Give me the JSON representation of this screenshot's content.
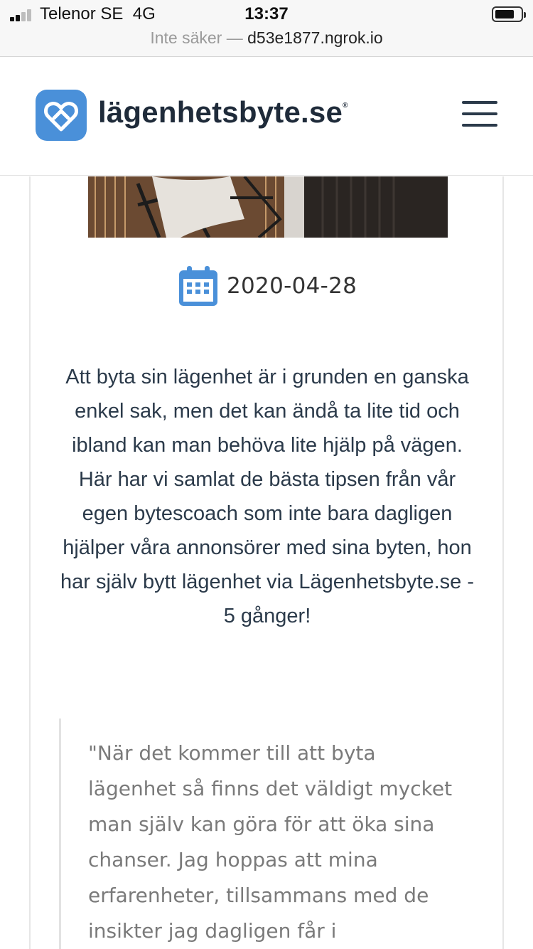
{
  "status_bar": {
    "carrier": "Telenor SE",
    "network": "4G",
    "time": "13:37"
  },
  "url_bar": {
    "security": "Inte säker —",
    "host": "d53e1877.ngrok.io"
  },
  "header": {
    "logo_text": "lägenhetsbyte.se",
    "logo_mark": "®"
  },
  "article": {
    "date": "2020-04-28",
    "intro": "Att byta sin lägenhet är i grunden en ganska enkel sak, men det kan ändå ta lite tid och ibland kan man behöva lite hjälp på vägen. Här har vi samlat de bästa tipsen från vår egen bytescoach som inte bara dagligen hjälper våra annonsörer med sina byten, hon har själv bytt lägenhet via Lägenhetsbyte.se - 5 gånger!",
    "quote": "\"När det kommer till att byta lägenhet så finns det väldigt mycket man själv kan göra för att öka sina chanser. Jag hoppas att mina erfarenheter, tillsammans med de insikter jag dagligen får i"
  },
  "colors": {
    "brand_blue": "#4a90d9",
    "text_dark": "#2b3a4a",
    "quote_gray": "#7a7a7a"
  },
  "icons": {
    "logo": "heart-house-icon",
    "menu": "hamburger-icon",
    "date": "calendar-icon"
  }
}
